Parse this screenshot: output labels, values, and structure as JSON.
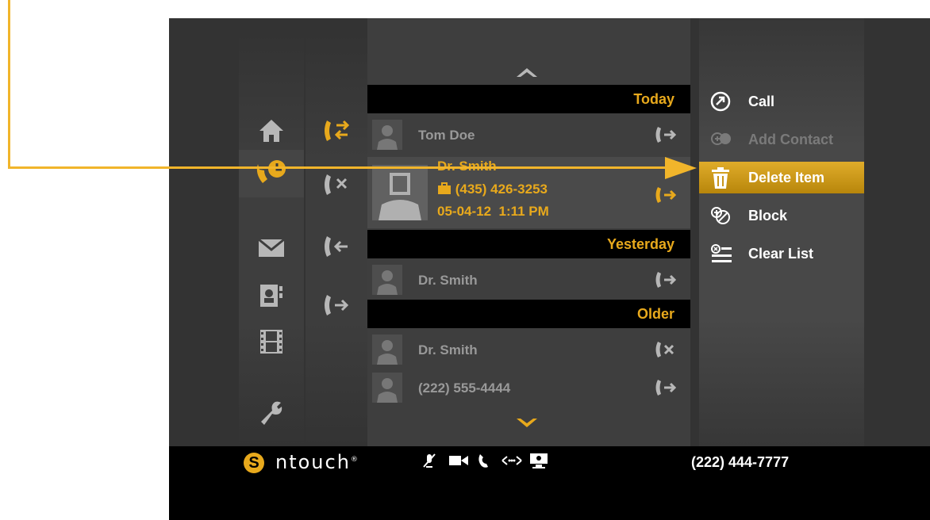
{
  "colors": {
    "accent": "#e8a91c",
    "background": "#333333",
    "callout": "#f1b52b"
  },
  "nav": [
    {
      "icon": "home-icon",
      "active": false
    },
    {
      "icon": "call-history-icon",
      "active": true
    },
    {
      "icon": "mail-icon",
      "active": false
    },
    {
      "icon": "contacts-icon",
      "active": false
    },
    {
      "icon": "film-icon",
      "active": false
    },
    {
      "icon": "wrench-icon",
      "active": false
    }
  ],
  "subnav": [
    {
      "icon": "all-calls-icon",
      "active": true
    },
    {
      "icon": "missed-calls-icon",
      "active": false
    },
    {
      "icon": "incoming-calls-icon",
      "active": false
    },
    {
      "icon": "outgoing-calls-icon",
      "active": false
    }
  ],
  "list": {
    "sections": {
      "today": "Today",
      "yesterday": "Yesterday",
      "older": "Older"
    },
    "rows": [
      {
        "name": "Tom Doe",
        "type": "outgoing"
      },
      {
        "name": "Dr. Smith",
        "type": "outgoing"
      },
      {
        "name": "Dr. Smith",
        "type": "missed"
      },
      {
        "name": "(222) 555-4444",
        "type": "outgoing"
      }
    ],
    "selected": {
      "name": "Dr. Smith",
      "phone": "(435) 426-3253",
      "datetime": "05-04-12  1:11 PM",
      "type": "outgoing"
    }
  },
  "menu": {
    "items": [
      {
        "label": "Call",
        "icon": "call-icon",
        "state": "normal"
      },
      {
        "label": "Add Contact",
        "icon": "add-contact-icon",
        "state": "disabled"
      },
      {
        "label": "Delete Item",
        "icon": "trash-icon",
        "state": "active"
      },
      {
        "label": "Block",
        "icon": "block-icon",
        "state": "normal"
      },
      {
        "label": "Clear List",
        "icon": "clear-list-icon",
        "state": "normal"
      }
    ]
  },
  "footer": {
    "brand_letter": "S",
    "brand_name": "ntouch",
    "brand_mark": "®",
    "phone": "(222) 444-7777",
    "status_icons": [
      "mic-muted-icon",
      "video-camera-icon",
      "phone-icon",
      "network-icon",
      "display-icon"
    ]
  }
}
